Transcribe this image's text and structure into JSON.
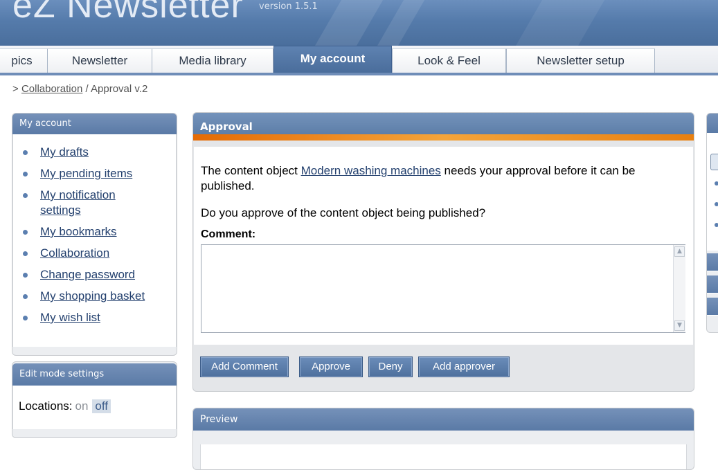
{
  "header": {
    "app_title": "eZ Newsletter",
    "version": "version 1.5.1"
  },
  "tabs": [
    {
      "label": "pics",
      "active": false
    },
    {
      "label": "Newsletter",
      "active": false
    },
    {
      "label": "Media library",
      "active": false
    },
    {
      "label": "My account",
      "active": true
    },
    {
      "label": "Look & Feel",
      "active": false
    },
    {
      "label": "Newsletter setup",
      "active": false
    }
  ],
  "breadcrumb": {
    "prefix": "> ",
    "link": "Collaboration",
    "separator": " / ",
    "current": "Approval v.2"
  },
  "sidebar": {
    "account_title": "My account",
    "items": [
      {
        "label": "My drafts"
      },
      {
        "label": "My pending items"
      },
      {
        "label": "My notification settings"
      },
      {
        "label": "My bookmarks"
      },
      {
        "label": "Collaboration"
      },
      {
        "label": "Change password"
      },
      {
        "label": "My shopping basket"
      },
      {
        "label": "My wish list"
      }
    ],
    "edit_mode_title": "Edit mode settings",
    "locations_label": "Locations:",
    "locations_on": "on",
    "locations_off": "off"
  },
  "approval": {
    "title": "Approval",
    "text_before_link": "The content object ",
    "object_link": "Modern washing machines",
    "text_after_link": " needs your approval before it can be published.",
    "question": "Do you approve of the content object being published?",
    "comment_label": "Comment:",
    "comment_value": "",
    "buttons": {
      "add_comment": "Add Comment",
      "approve": "Approve",
      "deny": "Deny",
      "add_approver": "Add approver"
    }
  },
  "preview": {
    "title": "Preview"
  },
  "colors": {
    "header_blue": "#557bab",
    "accent_orange": "#e07a0f",
    "link": "#23406e"
  }
}
